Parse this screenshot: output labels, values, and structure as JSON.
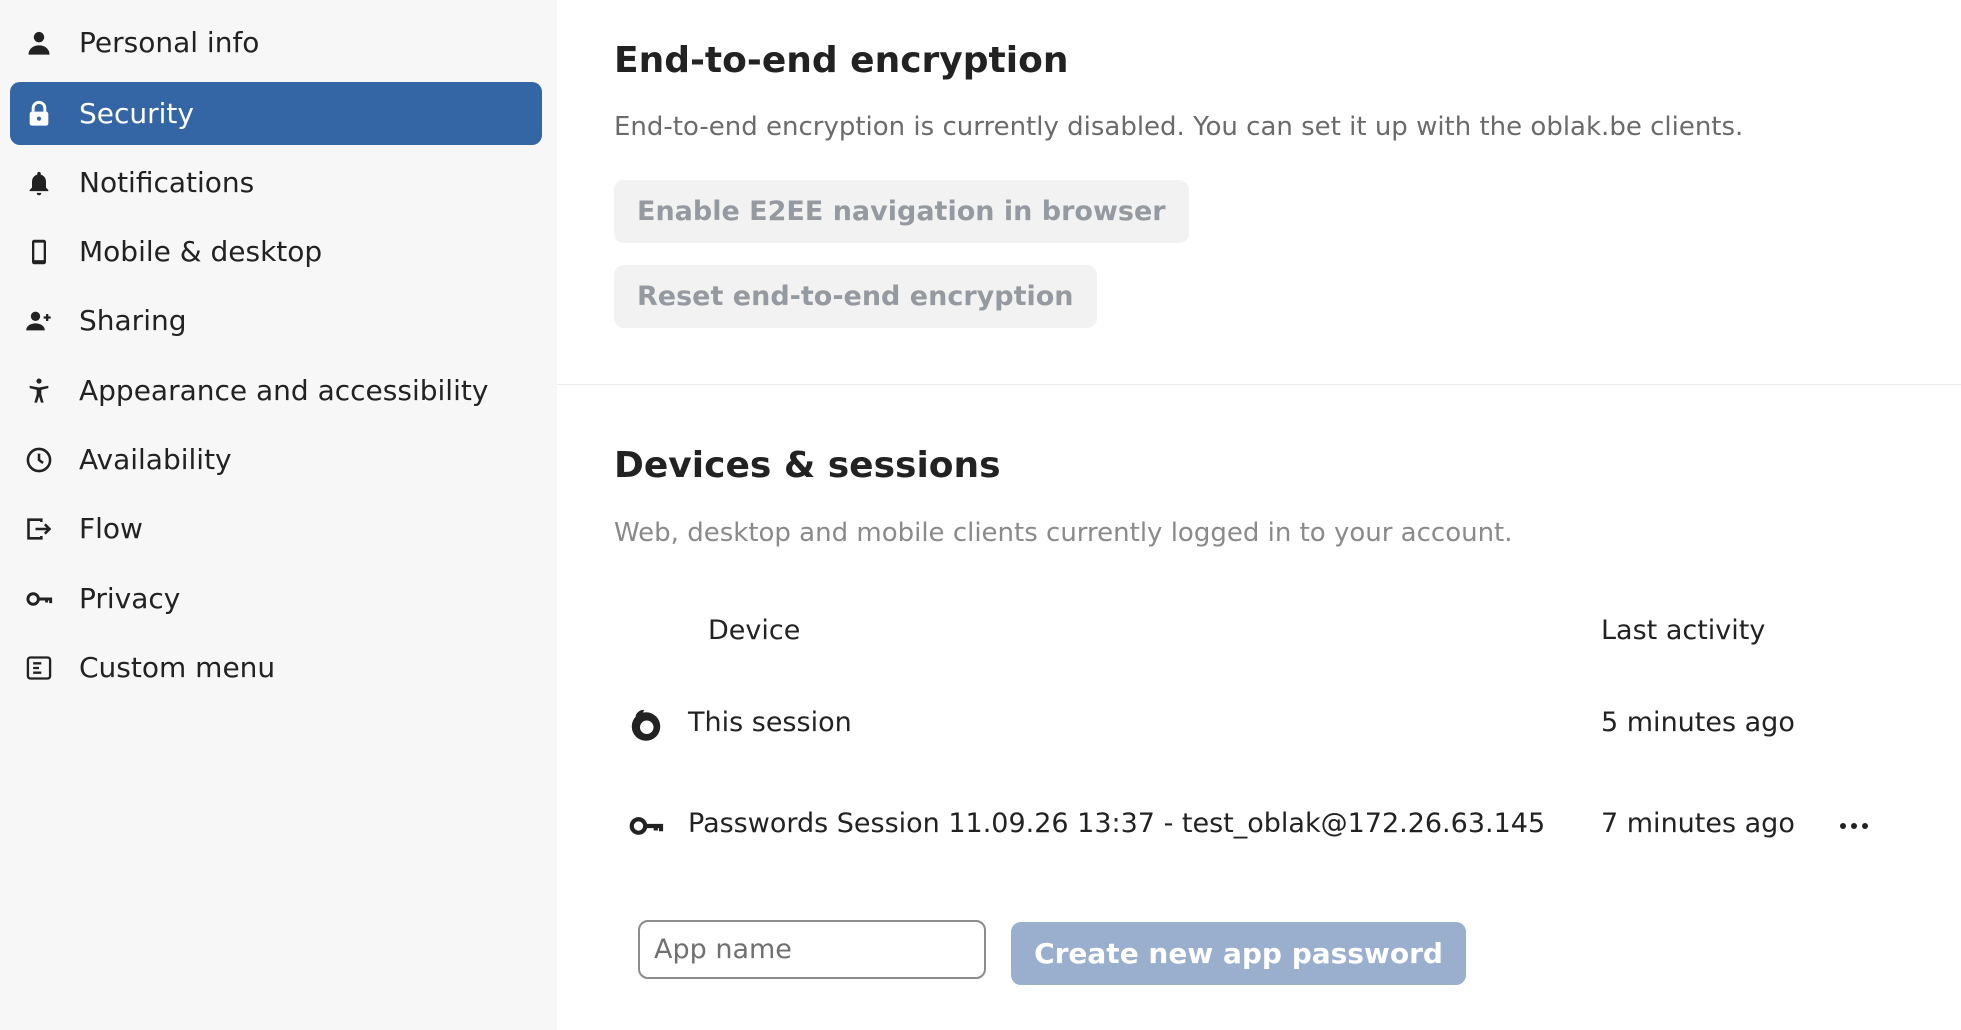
{
  "sidebar": {
    "items": [
      {
        "label": "Personal info",
        "icon": "person-icon"
      },
      {
        "label": "Security",
        "icon": "lock-icon",
        "active": true
      },
      {
        "label": "Notifications",
        "icon": "bell-icon"
      },
      {
        "label": "Mobile & desktop",
        "icon": "phone-icon"
      },
      {
        "label": "Sharing",
        "icon": "share-user-icon"
      },
      {
        "label": "Appearance and accessibility",
        "icon": "accessibility-icon"
      },
      {
        "label": "Availability",
        "icon": "clock-icon"
      },
      {
        "label": "Flow",
        "icon": "flow-icon"
      },
      {
        "label": "Privacy",
        "icon": "key-icon"
      },
      {
        "label": "Custom menu",
        "icon": "menu-icon"
      }
    ]
  },
  "e2ee": {
    "title": "End-to-end encryption",
    "description": "End-to-end encryption is currently disabled. You can set it up with the oblak.be clients.",
    "enable_button": "Enable E2EE navigation in browser",
    "reset_button": "Reset end-to-end encryption"
  },
  "devices": {
    "title": "Devices & sessions",
    "description": "Web, desktop and mobile clients currently logged in to your account.",
    "columns": {
      "device": "Device",
      "last_activity": "Last activity"
    },
    "rows": [
      {
        "icon": "firefox-icon",
        "device": "This session",
        "last_activity": "5 minutes ago"
      },
      {
        "icon": "key-icon",
        "device": "Passwords Session 11.09.26 13:37 - test_oblak@172.26.63.145",
        "last_activity": "7 minutes ago"
      }
    ],
    "app_name_placeholder": "App name",
    "create_button": "Create new app password"
  },
  "colors": {
    "accent": "#3465a4",
    "sidebar_bg": "#f7f7f7",
    "disabled_primary": "#9aaecd"
  }
}
